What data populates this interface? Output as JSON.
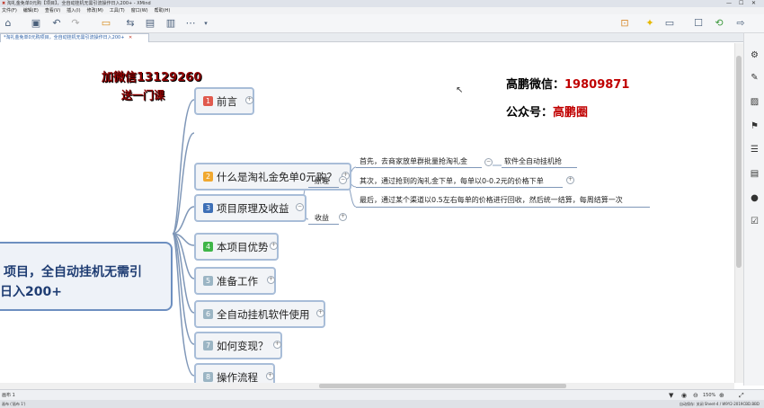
{
  "window": {
    "title": "淘礼金免单0元购【项目】，全自动挂机无需引流操作日入200+ - XMind",
    "menu": [
      "文件(F)",
      "编辑(E)",
      "查看(V)",
      "插入(I)",
      "修改(M)",
      "工具(T)",
      "窗口(W)",
      "帮助(H)"
    ]
  },
  "tab": {
    "label": "*淘礼金免单0元购项目，全自动挂机无需引流操作日入200+"
  },
  "mindmap": {
    "central_line1": "项目，全自动挂机无需引",
    "central_line2": "日入200+",
    "topics": [
      {
        "num": "1",
        "label": "前言",
        "color": "#e05a4e"
      },
      {
        "num": "2",
        "label": "什么是淘礼金免单0元购？",
        "color": "#f0a830"
      },
      {
        "num": "3",
        "label": "项目原理及收益",
        "color": "#3d6fb6"
      },
      {
        "num": "4",
        "label": "本项目优势",
        "color": "#3fb548"
      },
      {
        "num": "5",
        "label": "准备工作",
        "color": "#9bb5c4"
      },
      {
        "num": "6",
        "label": "全自动挂机软件使用",
        "color": "#9bb5c4"
      },
      {
        "num": "7",
        "label": "如何变现？",
        "color": "#9bb5c4"
      },
      {
        "num": "8",
        "label": "操作流程",
        "color": "#9bb5c4"
      }
    ],
    "sub_yuanli": "原理",
    "sub_shouyi": "收益",
    "leaf1": "首先，去商家放单群批量抢淘礼金",
    "leaf1_child": "软件全自动挂机抢",
    "leaf2": "其次，通过抢到的淘礼金下单，每单以0-0.2元的价格下单",
    "leaf3": "最后，通过某个渠道以0.5左右每单的价格进行回收，然后统一结算，每周结算一次"
  },
  "watermark": {
    "line1": "加微信13129260",
    "line2": "送一门课",
    "wechat_label": "高鹏微信：",
    "wechat_value": "19809871",
    "gzh_label": "公众号：",
    "gzh_value": "高鹏圈"
  },
  "sheet": {
    "label": "画布 1",
    "zoom": "150%"
  },
  "status": {
    "left": "画布 ('画布 1')",
    "right": "自动保存: 关闭    Sheet-4 / W9Y2-2019CBD.BBD"
  }
}
